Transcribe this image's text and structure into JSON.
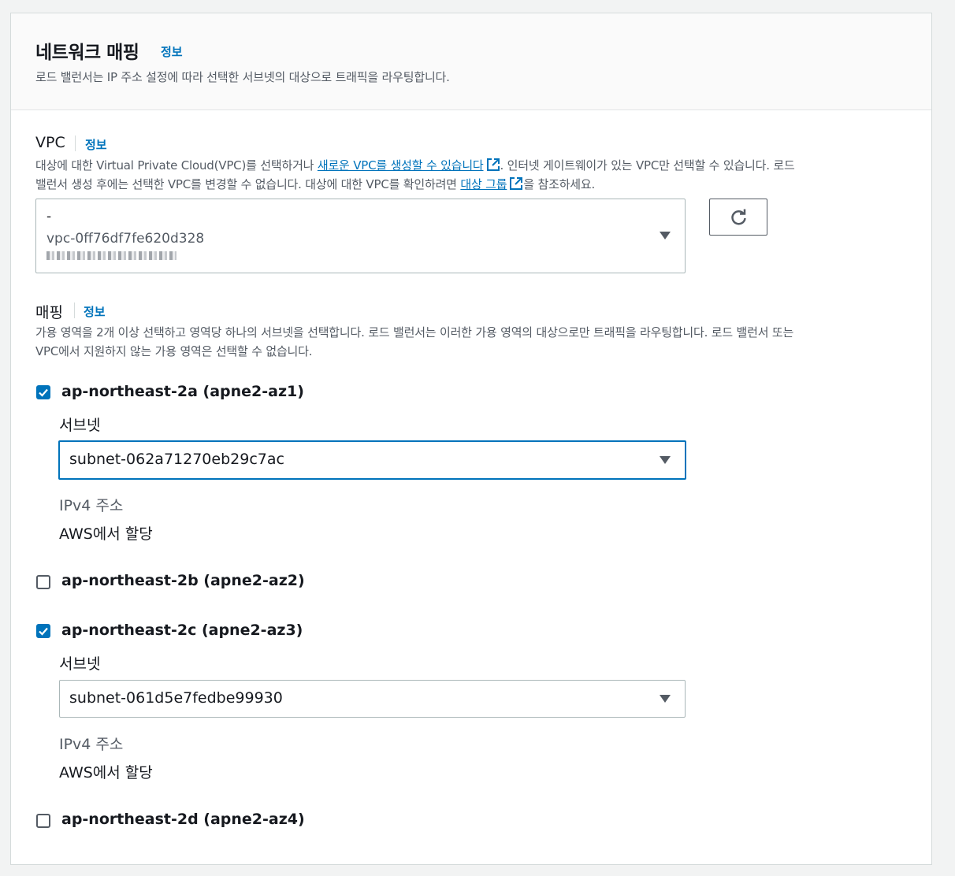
{
  "header": {
    "title": "네트워크 매핑",
    "info": "정보",
    "description": "로드 밸런서는 IP 주소 설정에 따라 선택한 서브넷의 대상으로 트래픽을 라우팅합니다."
  },
  "vpc": {
    "label": "VPC",
    "info": "정보",
    "desc_part1": "대상에 대한 Virtual Private Cloud(VPC)를 선택하거나 ",
    "desc_link1": "새로운 VPC를 생성할 수 있습니다",
    "desc_part2": ". 인터넷 게이트웨이가 있는 VPC만 선택할 수 있습니다. 로드",
    "desc_part3": "밸런서 생성 후에는 선택한 VPC를 변경할 수 없습니다. 대상에 대한 VPC를 확인하려면 ",
    "desc_link2": "대상 그룹",
    "desc_part4": "을 참조하세요.",
    "selected_name": "-",
    "selected_id": "vpc-0ff76df7fe620d328",
    "refresh_icon": "refresh-icon"
  },
  "mapping": {
    "label": "매핑",
    "info": "정보",
    "desc_line1": "가용 영역을 2개 이상 선택하고 영역당 하나의 서브넷을 선택합니다. 로드 밸런서는 이러한 가용 영역의 대상으로만 트래픽을 라우팅합니다. 로드 밸런서 또는",
    "desc_line2": "VPC에서 지원하지 않는 가용 영역은 선택할 수 없습니다.",
    "zones": [
      {
        "label": "ap-northeast-2a (apne2-az1)",
        "checked": true,
        "subnet_label": "서브넷",
        "subnet_value": "subnet-062a71270eb29c7ac",
        "ipv4_label": "IPv4 주소",
        "ipv4_value": "AWS에서 할당"
      },
      {
        "label": "ap-northeast-2b (apne2-az2)",
        "checked": false
      },
      {
        "label": "ap-northeast-2c (apne2-az3)",
        "checked": true,
        "subnet_label": "서브넷",
        "subnet_value": "subnet-061d5e7fedbe99930",
        "ipv4_label": "IPv4 주소",
        "ipv4_value": "AWS에서 할당"
      },
      {
        "label": "ap-northeast-2d (apne2-az4)",
        "checked": false
      }
    ]
  },
  "colors": {
    "accent": "#0073bb",
    "text": "#16191f",
    "muted": "#545b64",
    "border": "#aab7b8"
  }
}
